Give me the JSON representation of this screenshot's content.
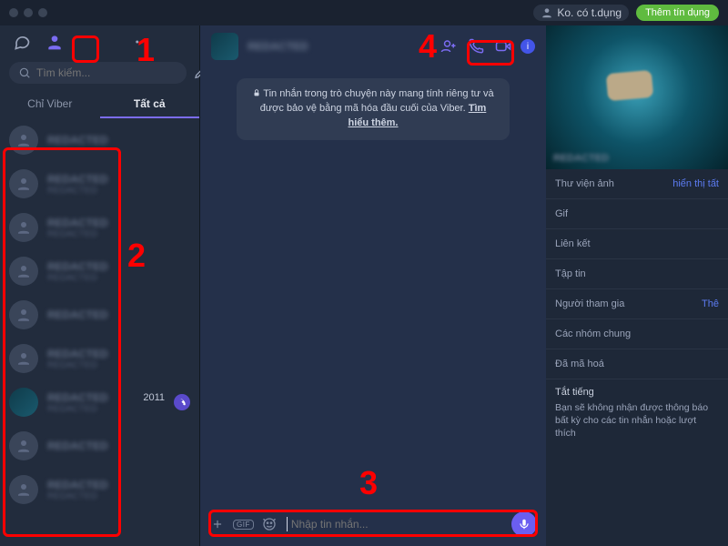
{
  "titlebar": {
    "credit_label": "Ko. có t.dụng",
    "add_credit_button": "Thêm tín dụng"
  },
  "sidebar": {
    "search_placeholder": "Tìm kiếm...",
    "tabs": {
      "viber_only": "Chỉ Viber",
      "all": "Tất cả"
    },
    "contacts": [
      {
        "name": "REDACTED",
        "sub": "",
        "special": false
      },
      {
        "name": "REDACTED",
        "sub": "REDACTED",
        "special": false
      },
      {
        "name": "REDACTED",
        "sub": "REDACTED",
        "special": false
      },
      {
        "name": "REDACTED",
        "sub": "REDACTED",
        "special": false
      },
      {
        "name": "REDACTED",
        "sub": "",
        "special": false
      },
      {
        "name": "REDACTED",
        "sub": "REDACTED",
        "special": false
      },
      {
        "name": "REDACTED",
        "sub": "2011",
        "special": true,
        "badge": true
      },
      {
        "name": "REDACTED",
        "sub": "",
        "special": false
      },
      {
        "name": "REDACTED",
        "sub": "REDACTED",
        "special": false
      }
    ]
  },
  "chat": {
    "header": {
      "name": "REDACTED"
    },
    "privacy_notice": "Tin nhắn trong trò chuyện này mang tính riêng tư và được bảo vệ bằng mã hóa đầu cuối của Viber.",
    "privacy_link": "Tìm hiểu thêm.",
    "input_placeholder": "Nhập tin nhắn..."
  },
  "right_panel": {
    "photo_library": "Thư viện ảnh",
    "show_all": "hiển thị tất",
    "gif": "Gif",
    "links": "Liên kết",
    "files": "Tập tin",
    "participants": "Người tham gia",
    "add": "Thê",
    "common_groups": "Các nhóm chung",
    "encrypted": "Đã mã hoá",
    "mute_title": "Tắt tiếng",
    "mute_desc": "Bạn sẽ không nhận được thông báo bất kỳ cho các tin nhắn hoặc lượt thích"
  },
  "annotations": {
    "n1": "1",
    "n2": "2",
    "n3": "3",
    "n4": "4"
  },
  "icons": {
    "gif": "GIF"
  }
}
